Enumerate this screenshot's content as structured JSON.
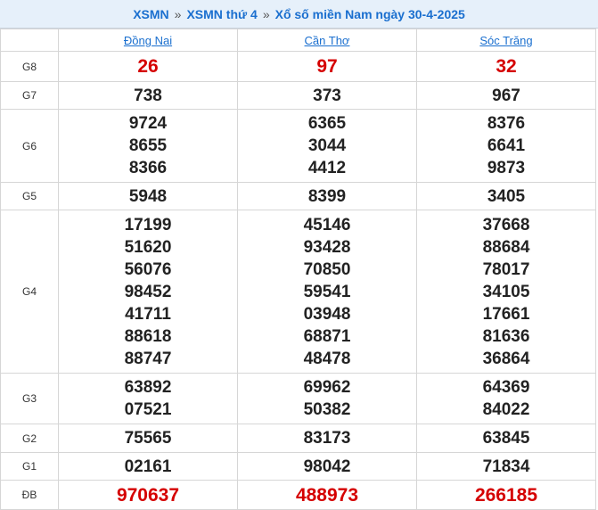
{
  "breadcrumb": {
    "link1": "XSMN",
    "separator": "»",
    "link2": "XSMN thứ 4",
    "current": "Xổ số miền Nam ngày 30-4-2025"
  },
  "provinces": [
    "Đồng Nai",
    "Cần Thơ",
    "Sóc Trăng"
  ],
  "prizes": [
    {
      "label": "G8",
      "highlight": true,
      "values": [
        [
          "26"
        ],
        [
          "97"
        ],
        [
          "32"
        ]
      ]
    },
    {
      "label": "G7",
      "highlight": false,
      "values": [
        [
          "738"
        ],
        [
          "373"
        ],
        [
          "967"
        ]
      ]
    },
    {
      "label": "G6",
      "highlight": false,
      "values": [
        [
          "9724",
          "8655",
          "8366"
        ],
        [
          "6365",
          "3044",
          "4412"
        ],
        [
          "8376",
          "6641",
          "9873"
        ]
      ]
    },
    {
      "label": "G5",
      "highlight": false,
      "values": [
        [
          "5948"
        ],
        [
          "8399"
        ],
        [
          "3405"
        ]
      ]
    },
    {
      "label": "G4",
      "highlight": false,
      "values": [
        [
          "17199",
          "51620",
          "56076",
          "98452",
          "41711",
          "88618",
          "88747"
        ],
        [
          "45146",
          "93428",
          "70850",
          "59541",
          "03948",
          "68871",
          "48478"
        ],
        [
          "37668",
          "88684",
          "78017",
          "34105",
          "17661",
          "81636",
          "36864"
        ]
      ]
    },
    {
      "label": "G3",
      "highlight": false,
      "values": [
        [
          "63892",
          "07521"
        ],
        [
          "69962",
          "50382"
        ],
        [
          "64369",
          "84022"
        ]
      ]
    },
    {
      "label": "G2",
      "highlight": false,
      "values": [
        [
          "75565"
        ],
        [
          "83173"
        ],
        [
          "63845"
        ]
      ]
    },
    {
      "label": "G1",
      "highlight": false,
      "values": [
        [
          "02161"
        ],
        [
          "98042"
        ],
        [
          "71834"
        ]
      ]
    },
    {
      "label": "ĐB",
      "highlight": true,
      "values": [
        [
          "970637"
        ],
        [
          "488973"
        ],
        [
          "266185"
        ]
      ]
    }
  ],
  "colors": {
    "accent": "#1a6fcf",
    "highlight": "#d50000",
    "header_bg": "#e6f0fa"
  }
}
